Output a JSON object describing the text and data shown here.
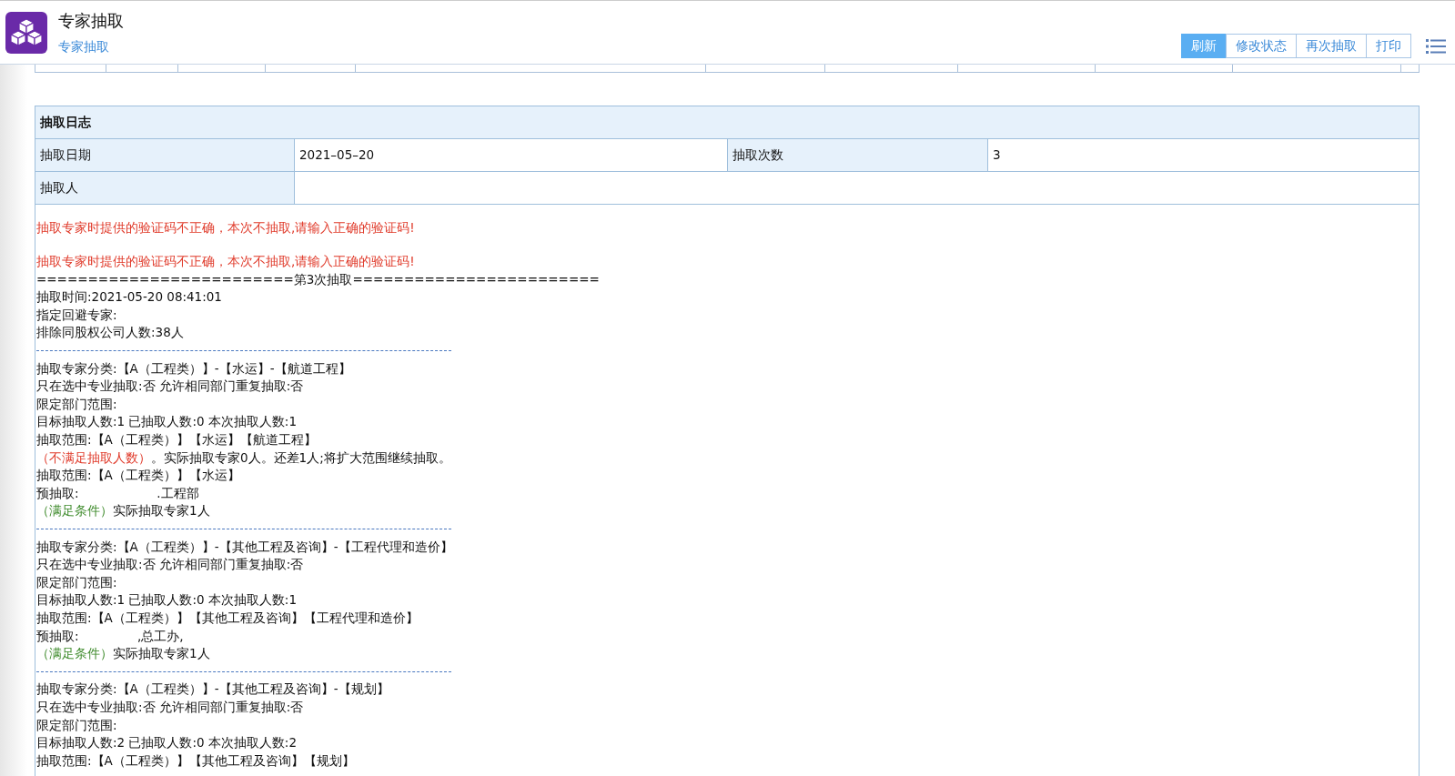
{
  "header": {
    "title": "专家抽取",
    "tab": "专家抽取",
    "buttons": [
      {
        "label": "刷新",
        "selected": true
      },
      {
        "label": "修改状态",
        "selected": false
      },
      {
        "label": "再次抽取",
        "selected": false
      },
      {
        "label": "打印",
        "selected": false
      }
    ]
  },
  "log_table": {
    "title": "抽取日志",
    "fields": [
      {
        "label": "抽取日期",
        "value": "2021–05–20"
      },
      {
        "label": "抽取次数",
        "value": "3"
      }
    ],
    "drawer": {
      "label": "抽取人"
    }
  },
  "log_lines": [
    {
      "kind": "error",
      "text": "抽取专家时提供的验证码不正确，本次不抽取,请输入正确的验证码!"
    },
    {
      "kind": "blank"
    },
    {
      "kind": "error",
      "text": "抽取专家时提供的验证码不正确，本次不抽取,请输入正确的验证码!"
    },
    {
      "kind": "text",
      "text": "=========================第3次抽取========================"
    },
    {
      "kind": "text",
      "text": "抽取时间:2021-05-20 08:41:01"
    },
    {
      "kind": "text",
      "text": "指定回避专家:"
    },
    {
      "kind": "text",
      "text": "排除同股权公司人数:38人"
    },
    {
      "kind": "rule"
    },
    {
      "kind": "text",
      "text": "抽取专家分类:【A（工程类）】-【水运】-【航道工程】"
    },
    {
      "kind": "text",
      "text": "只在选中专业抽取:否 允许相同部门重复抽取:否"
    },
    {
      "kind": "text",
      "text": "限定部门范围:"
    },
    {
      "kind": "text",
      "text": "目标抽取人数:1 已抽取人数:0 本次抽取人数:1"
    },
    {
      "kind": "text",
      "text": "抽取范围:【A（工程类）】【水运】【航道工程】"
    },
    {
      "kind": "status",
      "status": "（不满足抽取人数）",
      "color": "#e03a2a",
      "text": "。实际抽取专家0人。还差1人;将扩大范围继续抽取。"
    },
    {
      "kind": "text",
      "text": "抽取范围:【A（工程类）】【水运】"
    },
    {
      "kind": "text",
      "text": "预抽取:                    .工程部"
    },
    {
      "kind": "status",
      "status": "（满足条件）",
      "color": "#3d8a2a",
      "text": "实际抽取专家1人"
    },
    {
      "kind": "rule"
    },
    {
      "kind": "text",
      "text": "抽取专家分类:【A（工程类）】-【其他工程及咨询】-【工程代理和造价】"
    },
    {
      "kind": "text",
      "text": "只在选中专业抽取:否 允许相同部门重复抽取:否"
    },
    {
      "kind": "text",
      "text": "限定部门范围:"
    },
    {
      "kind": "text",
      "text": "目标抽取人数:1 已抽取人数:0 本次抽取人数:1"
    },
    {
      "kind": "text",
      "text": "抽取范围:【A（工程类）】【其他工程及咨询】【工程代理和造价】"
    },
    {
      "kind": "text",
      "text": "预抽取:               ,总工办,"
    },
    {
      "kind": "status",
      "status": "（满足条件）",
      "color": "#3d8a2a",
      "text": "实际抽取专家1人"
    },
    {
      "kind": "rule"
    },
    {
      "kind": "text",
      "text": "抽取专家分类:【A（工程类）】-【其他工程及咨询】-【规划】"
    },
    {
      "kind": "text",
      "text": "只在选中专业抽取:否 允许相同部门重复抽取:否"
    },
    {
      "kind": "text",
      "text": "限定部门范围:"
    },
    {
      "kind": "text",
      "text": "目标抽取人数:2 已抽取人数:0 本次抽取人数:2"
    },
    {
      "kind": "text",
      "text": "抽取范围:【A（工程类）】【其他工程及咨询】【规划】"
    }
  ]
}
